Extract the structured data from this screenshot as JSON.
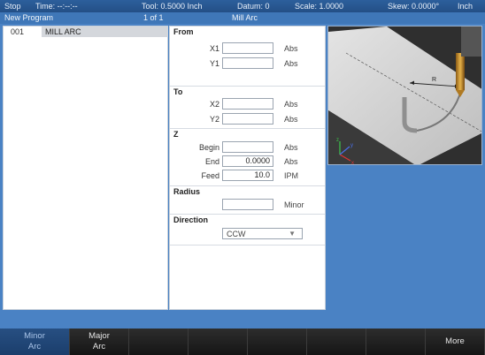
{
  "status": {
    "mode": "Stop",
    "time": "Time:  --:--:--",
    "tool": "Tool: 0.5000 Inch",
    "datum": "Datum: 0",
    "scale": "Scale: 1.0000",
    "skew": "Skew: 0.0000°",
    "units": "Inch"
  },
  "header": {
    "program": "New Program",
    "page": "1 of 1",
    "step_title": "Mill Arc"
  },
  "program_list": [
    {
      "number": "001",
      "name": "MILL ARC"
    }
  ],
  "form": {
    "from": {
      "title": "From",
      "x1_label": "X1",
      "x1_value": "",
      "x1_unit": "Abs",
      "y1_label": "Y1",
      "y1_value": "",
      "y1_unit": "Abs"
    },
    "to": {
      "title": "To",
      "x2_label": "X2",
      "x2_value": "",
      "x2_unit": "Abs",
      "y2_label": "Y2",
      "y2_value": "",
      "y2_unit": "Abs"
    },
    "z": {
      "title": "Z",
      "begin_label": "Begin",
      "begin_value": "",
      "begin_unit": "Abs",
      "end_label": "End",
      "end_value": "0.0000",
      "end_unit": "Abs",
      "feed_label": "Feed",
      "feed_value": "10.0",
      "feed_unit": "IPM"
    },
    "radius": {
      "title": "Radius",
      "value": "",
      "unit": "Minor"
    },
    "direction": {
      "title": "Direction",
      "selected": "CCW"
    }
  },
  "preview": {
    "radius_label": "R",
    "axis_x": "x",
    "axis_y": "y",
    "axis_z": "z"
  },
  "softkeys": [
    {
      "line1": "Minor",
      "line2": "Arc",
      "active": true
    },
    {
      "line1": "Major",
      "line2": "Arc",
      "active": false
    },
    {
      "line1": "",
      "line2": "",
      "active": false
    },
    {
      "line1": "",
      "line2": "",
      "active": false
    },
    {
      "line1": "",
      "line2": "",
      "active": false
    },
    {
      "line1": "",
      "line2": "",
      "active": false
    },
    {
      "line1": "",
      "line2": "",
      "active": false
    },
    {
      "line1": "More",
      "line2": "",
      "active": false
    }
  ],
  "colors": {
    "background": "#4a82c4",
    "active_softkey": "#274f82",
    "tool_gold": "#c8922a"
  }
}
